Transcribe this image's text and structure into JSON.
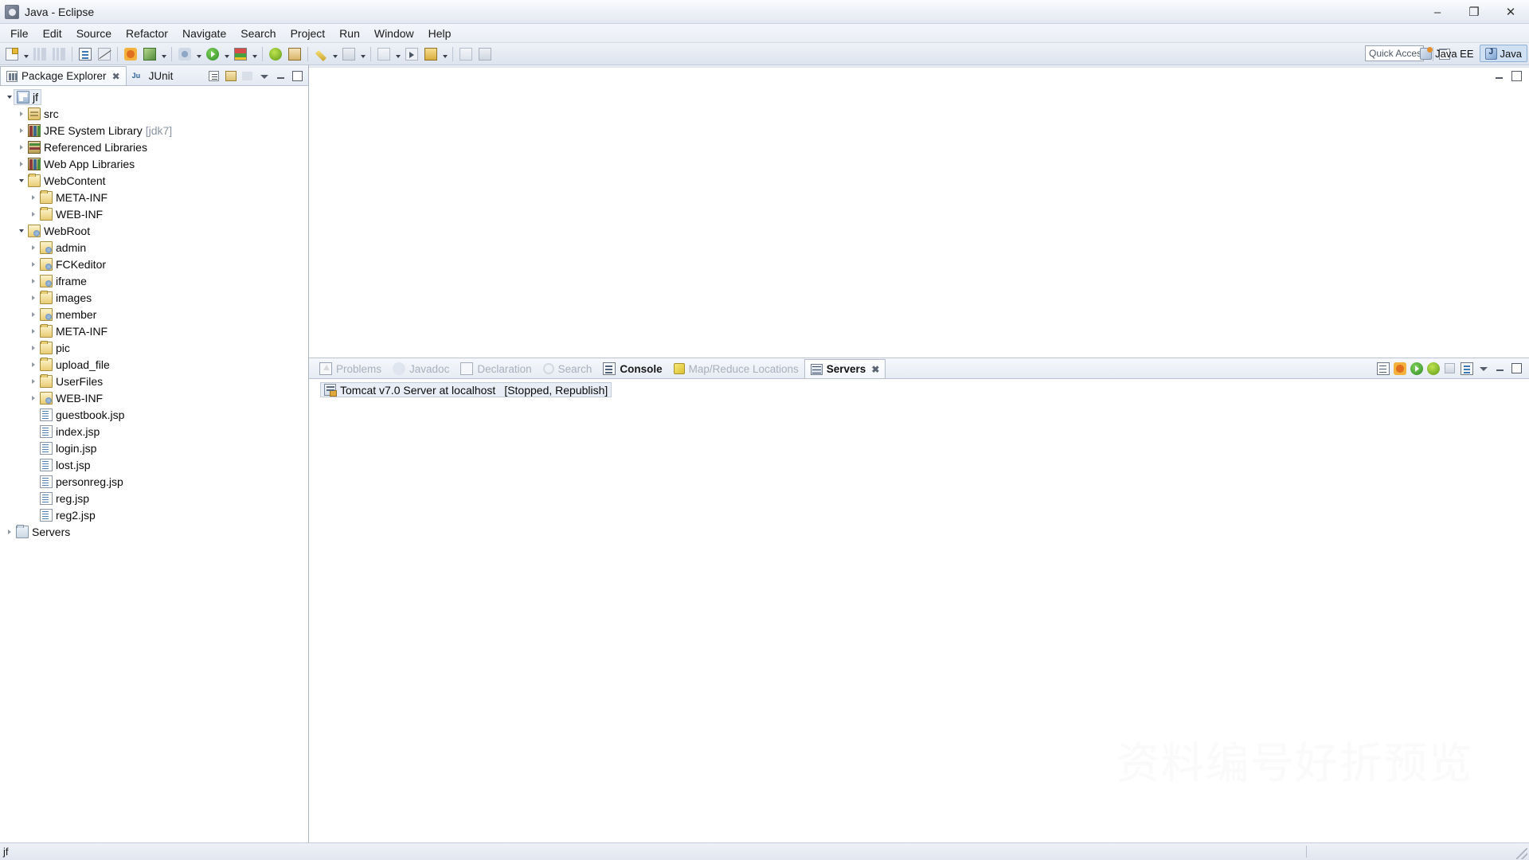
{
  "window": {
    "title": "Java - Eclipse",
    "app_icon": "eclipse-icon",
    "buttons": {
      "minimize": "–",
      "maximize": "❐",
      "close": "✕"
    }
  },
  "menubar": {
    "items": [
      "File",
      "Edit",
      "Source",
      "Refactor",
      "Navigate",
      "Search",
      "Project",
      "Run",
      "Window",
      "Help"
    ]
  },
  "toolbar": {
    "groups": [
      {
        "items": [
          {
            "name": "new-wizard-icon",
            "shape": "ic-newdoc",
            "dropdown": true
          },
          {
            "name": "save-icon",
            "shape": "ic-bars",
            "dropdown": false
          },
          {
            "name": "save-all-icon",
            "shape": "ic-bars",
            "dropdown": false
          }
        ]
      },
      {
        "items": [
          {
            "name": "print-icon",
            "shape": "ic-doc",
            "dropdown": false
          },
          {
            "name": "toggle-breakpoint-icon",
            "shape": "ic-strike",
            "dropdown": false
          }
        ]
      },
      {
        "items": [
          {
            "name": "new-java-class-icon",
            "shape": "ic-bug",
            "dropdown": false
          },
          {
            "name": "refresh-icon",
            "shape": "ic-green",
            "dropdown": true
          }
        ]
      },
      {
        "items": [
          {
            "name": "debug-icon",
            "shape": "ic-debug",
            "dropdown": true
          },
          {
            "name": "run-icon",
            "shape": "ic-run",
            "dropdown": true
          },
          {
            "name": "coverage-icon",
            "shape": "ic-coverage",
            "dropdown": true
          }
        ]
      },
      {
        "items": [
          {
            "name": "external-tools-icon",
            "shape": "ic-ext",
            "dropdown": false
          },
          {
            "name": "open-type-icon",
            "shape": "ic-book",
            "dropdown": false
          }
        ]
      },
      {
        "items": [
          {
            "name": "quick-fix-icon",
            "shape": "ic-pencil",
            "dropdown": true
          },
          {
            "name": "search-icon",
            "shape": "ic-gray",
            "dropdown": true
          }
        ]
      },
      {
        "items": [
          {
            "name": "next-annotation-icon",
            "shape": "ic-gray2",
            "dropdown": true
          },
          {
            "name": "previous-edit-icon",
            "shape": "ic-arrowright",
            "dropdown": false
          },
          {
            "name": "last-edit-location-icon",
            "shape": "ic-yellowbox",
            "dropdown": true
          }
        ]
      },
      {
        "items": [
          {
            "name": "back-icon",
            "shape": "ic-gray2",
            "dropdown": false
          },
          {
            "name": "forward-icon",
            "shape": "ic-gray",
            "dropdown": false
          }
        ]
      }
    ],
    "quick_access_placeholder": "Quick Access",
    "open_perspective_icon": "open-perspective-icon",
    "perspectives": [
      {
        "label": "Java EE",
        "icon": "java-ee-perspective-icon",
        "active": false
      },
      {
        "label": "Java",
        "icon": "java-perspective-icon",
        "active": true
      }
    ]
  },
  "package_explorer": {
    "tabs": [
      {
        "label": "Package Explorer",
        "icon": "package-explorer-icon",
        "active": true,
        "closable": true
      },
      {
        "label": "JUnit",
        "icon": "junit-icon",
        "active": false,
        "closable": false
      }
    ],
    "view_tools": [
      {
        "name": "collapse-all-icon"
      },
      {
        "name": "link-with-editor-icon"
      },
      {
        "name": "focus-on-active-task-icon"
      },
      {
        "name": "view-menu-icon"
      },
      {
        "name": "minimize-view-icon"
      },
      {
        "name": "maximize-view-icon"
      }
    ],
    "tree": [
      {
        "label": "jf",
        "sub": "",
        "indent": 0,
        "twisty": "open",
        "icon": "project-icon",
        "selected": true
      },
      {
        "label": "src",
        "sub": "",
        "indent": 1,
        "twisty": "closed",
        "icon": "source-folder-icon",
        "selected": false
      },
      {
        "label": "JRE System Library",
        "sub": "[jdk7]",
        "indent": 1,
        "twisty": "closed",
        "icon": "library-icon",
        "selected": false
      },
      {
        "label": "Referenced Libraries",
        "sub": "",
        "indent": 1,
        "twisty": "closed",
        "icon": "referenced-library-icon",
        "selected": false
      },
      {
        "label": "Web App Libraries",
        "sub": "",
        "indent": 1,
        "twisty": "closed",
        "icon": "library-icon",
        "selected": false
      },
      {
        "label": "WebContent",
        "sub": "",
        "indent": 1,
        "twisty": "open",
        "icon": "folder-icon",
        "selected": false
      },
      {
        "label": "META-INF",
        "sub": "",
        "indent": 2,
        "twisty": "closed",
        "icon": "folder-icon",
        "selected": false
      },
      {
        "label": "WEB-INF",
        "sub": "",
        "indent": 2,
        "twisty": "closed",
        "icon": "folder-icon",
        "selected": false
      },
      {
        "label": "WebRoot",
        "sub": "",
        "indent": 1,
        "twisty": "open",
        "icon": "web-folder-icon",
        "selected": false
      },
      {
        "label": "admin",
        "sub": "",
        "indent": 2,
        "twisty": "closed",
        "icon": "web-folder-icon",
        "selected": false
      },
      {
        "label": "FCKeditor",
        "sub": "",
        "indent": 2,
        "twisty": "closed",
        "icon": "web-folder-icon",
        "selected": false
      },
      {
        "label": "iframe",
        "sub": "",
        "indent": 2,
        "twisty": "closed",
        "icon": "web-folder-icon",
        "selected": false
      },
      {
        "label": "images",
        "sub": "",
        "indent": 2,
        "twisty": "closed",
        "icon": "folder-icon",
        "selected": false
      },
      {
        "label": "member",
        "sub": "",
        "indent": 2,
        "twisty": "closed",
        "icon": "web-folder-icon",
        "selected": false
      },
      {
        "label": "META-INF",
        "sub": "",
        "indent": 2,
        "twisty": "closed",
        "icon": "folder-icon",
        "selected": false
      },
      {
        "label": "pic",
        "sub": "",
        "indent": 2,
        "twisty": "closed",
        "icon": "folder-icon",
        "selected": false
      },
      {
        "label": "upload_file",
        "sub": "",
        "indent": 2,
        "twisty": "closed",
        "icon": "folder-icon",
        "selected": false
      },
      {
        "label": "UserFiles",
        "sub": "",
        "indent": 2,
        "twisty": "closed",
        "icon": "folder-icon",
        "selected": false
      },
      {
        "label": "WEB-INF",
        "sub": "",
        "indent": 2,
        "twisty": "closed",
        "icon": "web-folder-icon",
        "selected": false
      },
      {
        "label": "guestbook.jsp",
        "sub": "",
        "indent": 2,
        "twisty": "none",
        "icon": "jsp-file-icon",
        "selected": false
      },
      {
        "label": "index.jsp",
        "sub": "",
        "indent": 2,
        "twisty": "none",
        "icon": "jsp-file-icon",
        "selected": false
      },
      {
        "label": "login.jsp",
        "sub": "",
        "indent": 2,
        "twisty": "none",
        "icon": "jsp-file-icon",
        "selected": false
      },
      {
        "label": "lost.jsp",
        "sub": "",
        "indent": 2,
        "twisty": "none",
        "icon": "jsp-file-icon",
        "selected": false
      },
      {
        "label": "personreg.jsp",
        "sub": "",
        "indent": 2,
        "twisty": "none",
        "icon": "jsp-file-icon",
        "selected": false
      },
      {
        "label": "reg.jsp",
        "sub": "",
        "indent": 2,
        "twisty": "none",
        "icon": "jsp-file-icon",
        "selected": false
      },
      {
        "label": "reg2.jsp",
        "sub": "",
        "indent": 2,
        "twisty": "none",
        "icon": "jsp-file-icon",
        "selected": false
      },
      {
        "label": "Servers",
        "sub": "",
        "indent": 0,
        "twisty": "closed",
        "icon": "servers-folder-icon",
        "selected": false
      }
    ]
  },
  "editor_area": {
    "tools": [
      {
        "name": "restore-editor-icon"
      },
      {
        "name": "maximize-editor-icon"
      }
    ]
  },
  "bottom_panel": {
    "tabs": [
      {
        "label": "Problems",
        "icon": "problems-icon",
        "state": "inactive",
        "closable": false
      },
      {
        "label": "Javadoc",
        "icon": "javadoc-icon",
        "state": "inactive",
        "closable": false
      },
      {
        "label": "Declaration",
        "icon": "declaration-icon",
        "state": "inactive",
        "closable": false
      },
      {
        "label": "Search",
        "icon": "search-icon",
        "state": "inactive",
        "closable": false
      },
      {
        "label": "Console",
        "icon": "console-icon",
        "state": "semi",
        "closable": false
      },
      {
        "label": "Map/Reduce Locations",
        "icon": "map-reduce-icon",
        "state": "inactive",
        "closable": false
      },
      {
        "label": "Servers",
        "icon": "servers-icon",
        "state": "active",
        "closable": true
      }
    ],
    "tools": [
      {
        "name": "show-in-console-icon"
      },
      {
        "name": "debug-server-icon"
      },
      {
        "name": "start-server-icon"
      },
      {
        "name": "profile-server-icon"
      },
      {
        "name": "stop-server-icon"
      },
      {
        "name": "publish-server-icon"
      },
      {
        "name": "view-menu-icon"
      },
      {
        "name": "minimize-view-icon"
      },
      {
        "name": "maximize-view-icon"
      }
    ],
    "servers": [
      {
        "name": "Tomcat v7.0 Server at localhost",
        "status": "[Stopped, Republish]",
        "icon": "tomcat-server-icon"
      }
    ]
  },
  "watermark": {
    "text": "资料编号好折预览"
  },
  "statusbar": {
    "text": "jf",
    "resize_grip": "resize-grip-icon"
  }
}
